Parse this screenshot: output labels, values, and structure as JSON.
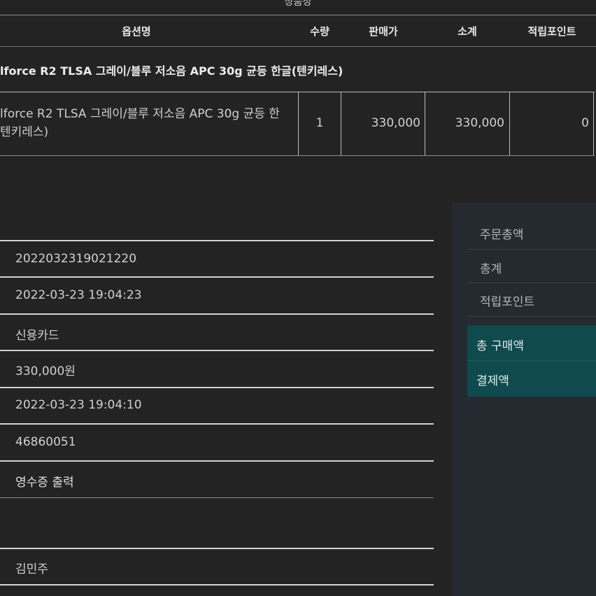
{
  "table": {
    "section_title": "상품정",
    "headers": {
      "option": "옵션명",
      "qty": "수량",
      "price": "판매가",
      "subtotal": "소계",
      "points": "적립포인트"
    },
    "group_title": "lforce R2 TLSA 그레이/블루 저소음 APC 30g 균등 한글(텐키레스)",
    "row": {
      "option_line1": "lforce R2 TLSA 그레이/블루 저소음 APC 30g 균등 한",
      "option_line2": "텐키레스)",
      "qty": "1",
      "price": "330,000",
      "subtotal": "330,000",
      "points": "0"
    }
  },
  "order_info": {
    "values": [
      "2022032319021220",
      "2022-03-23 19:04:23",
      "신용카드",
      "330,000원",
      "2022-03-23 19:04:10",
      "46860051",
      "영수증 출력"
    ],
    "buyer_name": "김민주"
  },
  "summary": {
    "order_total": "주문총액",
    "total": "총계",
    "points": "적립포인트",
    "total_purchase": "총 구매액",
    "payment": "결제액"
  },
  "colors": {
    "background": "#232323",
    "panel": "#242a2f",
    "accent": "#0e4a4e"
  }
}
